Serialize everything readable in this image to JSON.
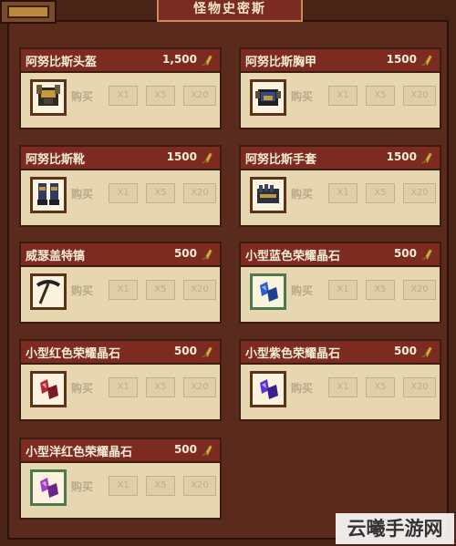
{
  "header": {
    "title": "怪物史密斯"
  },
  "ui": {
    "buy_label": "购买",
    "qty_1": "X1",
    "qty_5": "X5",
    "qty_20": "X20"
  },
  "items": [
    {
      "name": "阿努比斯头盔",
      "price": "1,500",
      "icon": "helmet-icon"
    },
    {
      "name": "阿努比斯胸甲",
      "price": "1500",
      "icon": "chestplate-icon"
    },
    {
      "name": "阿努比斯靴",
      "price": "1500",
      "icon": "boots-icon"
    },
    {
      "name": "阿努比斯手套",
      "price": "1500",
      "icon": "gloves-icon"
    },
    {
      "name": "威瑟盖特镐",
      "price": "500",
      "icon": "pickaxe-icon"
    },
    {
      "name": "小型蓝色荣耀晶石",
      "price": "500",
      "icon": "blue-crystal-icon"
    },
    {
      "name": "小型红色荣耀晶石",
      "price": "500",
      "icon": "red-crystal-icon"
    },
    {
      "name": "小型紫色荣耀晶石",
      "price": "500",
      "icon": "purple-crystal-icon"
    },
    {
      "name": "小型洋红色荣耀晶石",
      "price": "500",
      "icon": "magenta-crystal-icon"
    }
  ],
  "watermark": "云曦手游网"
}
